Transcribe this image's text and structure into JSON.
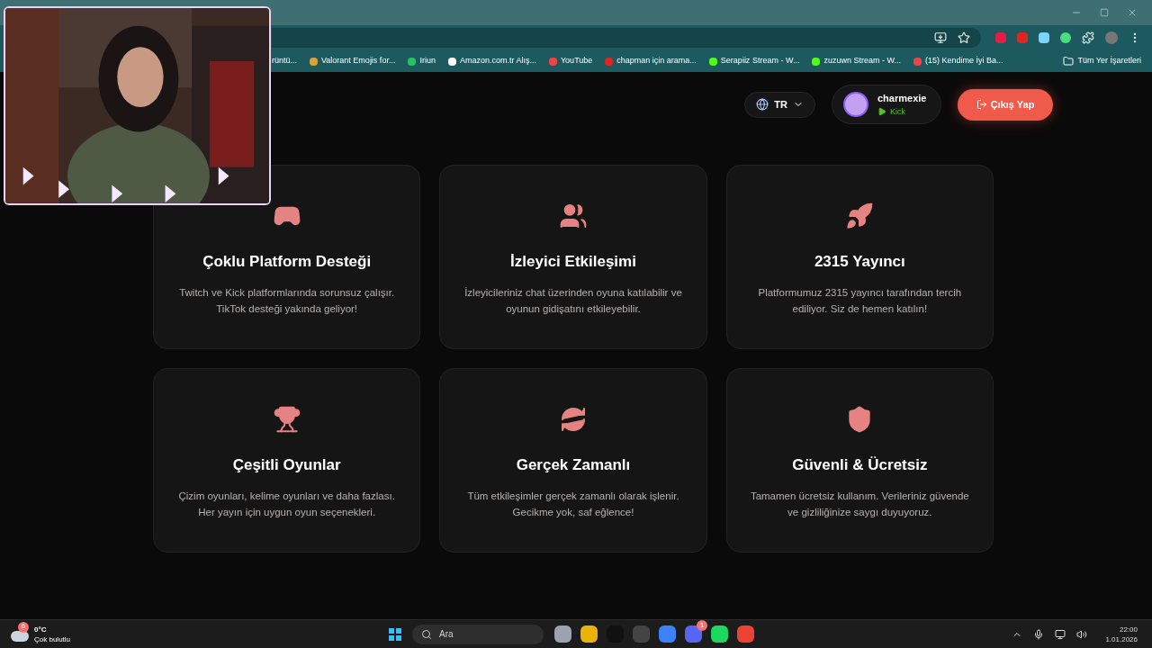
{
  "browser": {
    "bookmarks": [
      {
        "label": "rüntü..."
      },
      {
        "label": "Valorant Emojis for..."
      },
      {
        "label": "Iriun"
      },
      {
        "label": "Amazon.com.tr Alış..."
      },
      {
        "label": "YouTube"
      },
      {
        "label": "chapman için arama..."
      },
      {
        "label": "Serapiiz Stream - W..."
      },
      {
        "label": "zuzuwn Stream - W..."
      },
      {
        "label": "(15) Kendime İyi Ba..."
      }
    ],
    "all_bookmarks": "Tüm Yer İşaretleri"
  },
  "header": {
    "language": "TR",
    "user": {
      "name": "charmexie",
      "platform": "Kick"
    },
    "logout": "Çıkış Yap"
  },
  "features": [
    {
      "title": "Çoklu Platform Desteği",
      "description": "Twitch ve Kick platformlarında sorunsuz çalışır. TikTok desteği yakında geliyor!"
    },
    {
      "title": "İzleyici Etkileşimi",
      "description": "İzleyicileriniz chat üzerinden oyuna katılabilir ve oyunun gidişatını etkileyebilir."
    },
    {
      "title": "2315 Yayıncı",
      "description": "Platformumuz 2315 yayıncı tarafından tercih ediliyor. Siz de hemen katılın!"
    },
    {
      "title": "Çeşitli Oyunlar",
      "description": "Çizim oyunları, kelime oyunları ve daha fazlası. Her yayın için uygun oyun seçenekleri."
    },
    {
      "title": "Gerçek Zamanlı",
      "description": "Tüm etkileşimler gerçek zamanlı olarak işlenir. Gecikme yok, saf eğlence!"
    },
    {
      "title": "Güvenli & Ücretsiz",
      "description": "Tamamen ücretsiz kullanım. Verileriniz güvende ve gizliliğinize saygı duyuyoruz."
    }
  ],
  "taskbar": {
    "weather": {
      "badge": "6",
      "temperature": "0°C",
      "condition": "Çok bulutlu"
    },
    "search_placeholder": "Ara",
    "chat_app_badge": "1",
    "time": "22:00",
    "date": "1.01.2026"
  }
}
